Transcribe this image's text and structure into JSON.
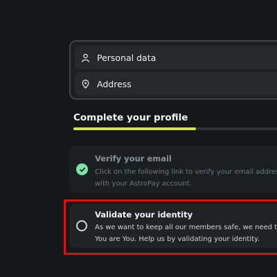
{
  "menu": {
    "items": [
      {
        "label": "Personal data",
        "icon": "user-icon"
      },
      {
        "label": "Address",
        "icon": "location-pin-icon"
      }
    ]
  },
  "profile": {
    "title": "Complete your profile",
    "progress": 0.59,
    "progress_color": "#d4e157"
  },
  "steps": {
    "email": {
      "title": "Verify your email",
      "desc_line1": "Click on the following link to verify your email address",
      "desc_line2": "with your AstroPay account.",
      "status": "completed",
      "status_color": "#7be3a6"
    },
    "identity": {
      "title": "Validate your identity",
      "desc_line1": "As we want to keep all our members safe, we need to",
      "desc_line2": "You are You. Help us by validating your identity.",
      "status": "pending"
    }
  },
  "highlight_color": "#d6111b"
}
